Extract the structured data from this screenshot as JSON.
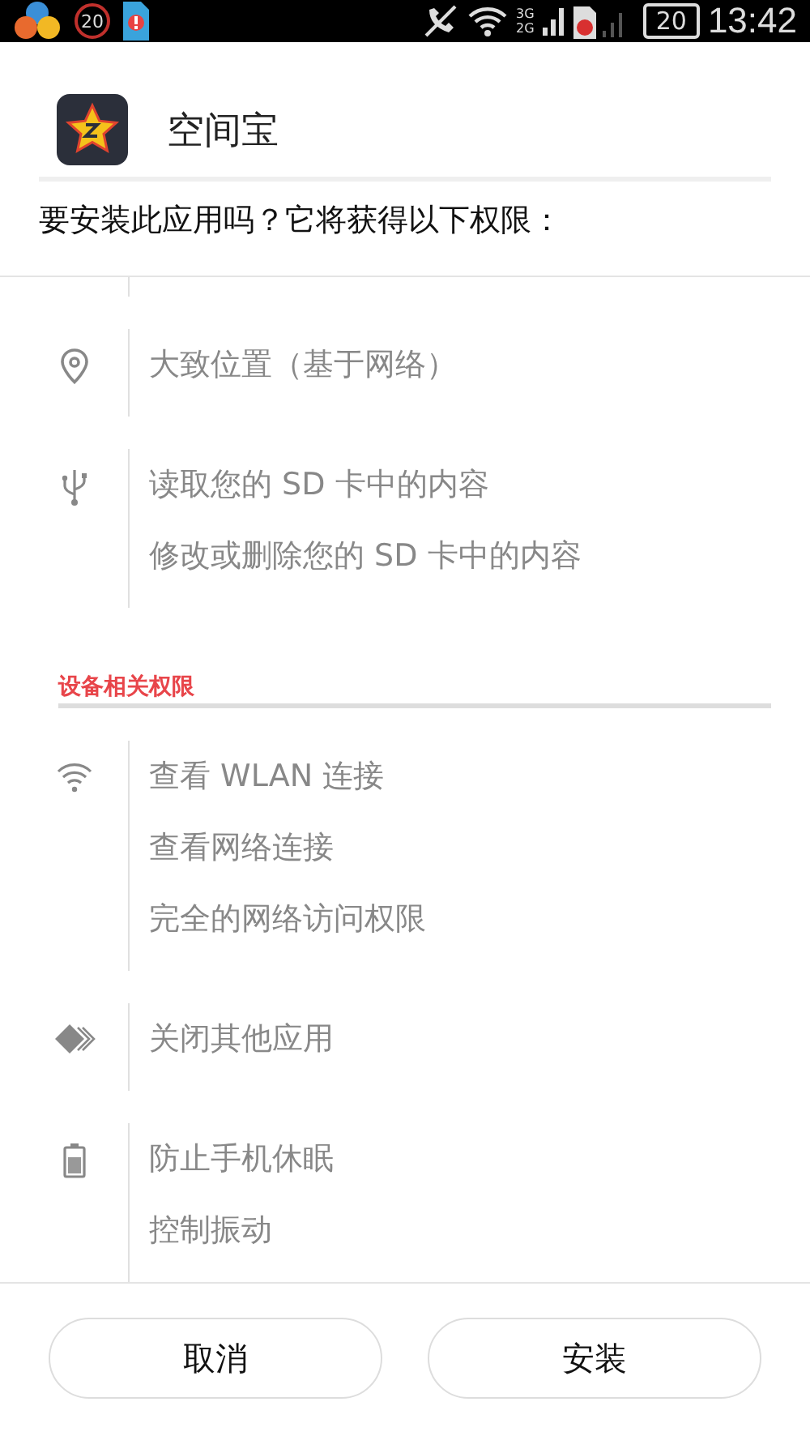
{
  "status_bar": {
    "notification_count": "20",
    "network_labels": [
      "3G",
      "2G"
    ],
    "battery": "20",
    "time": "13:42"
  },
  "app": {
    "name": "空间宝"
  },
  "prompt": "要安装此应用吗？它将获得以下权限：",
  "groups": [
    {
      "kind": "location",
      "items": [
        "大致位置（基于网络）"
      ]
    },
    {
      "kind": "usb",
      "items": [
        "读取您的 SD 卡中的内容",
        "修改或删除您的 SD 卡中的内容"
      ]
    }
  ],
  "device_section": {
    "heading": "设备相关权限",
    "groups": [
      {
        "kind": "wifi",
        "items": [
          "查看 WLAN 连接",
          "查看网络连接",
          "完全的网络访问权限"
        ]
      },
      {
        "kind": "apps",
        "items": [
          "关闭其他应用"
        ]
      },
      {
        "kind": "battery",
        "items": [
          "防止手机休眠",
          "控制振动"
        ]
      }
    ]
  },
  "buttons": [
    "取消",
    "安装"
  ]
}
